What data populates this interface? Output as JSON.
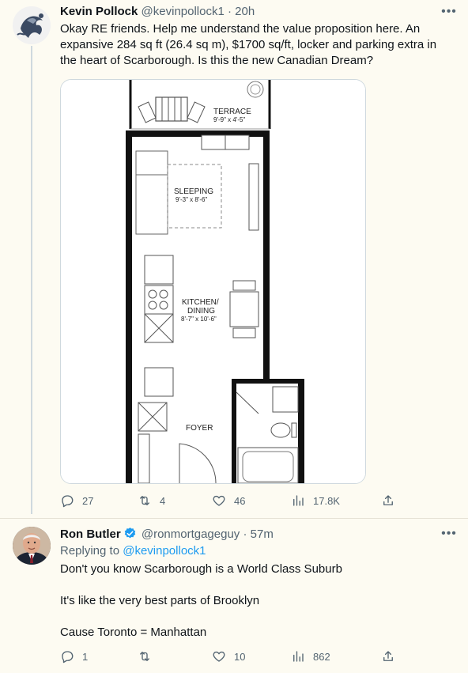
{
  "tweet1": {
    "author_name": "Kevin Pollock",
    "handle": "@kevinpollock1",
    "separator": "·",
    "time": "20h",
    "text_lines": [
      "Okay RE friends.  Help me understand the value proposition here.  An",
      "expansive 284 sq ft (26.4 sq m), $1700 sq/ft, locker and parking extra in",
      "the heart of Scarborough. Is this the new Canadian Dream?"
    ],
    "floorplan": {
      "terrace_label": "TERRACE",
      "terrace_dims": "9'-9\" x 4'-5\"",
      "sleeping_label": "SLEEPING",
      "sleeping_dims": "9'-3\" x 8'-6\"",
      "kitchen_label_1": "KITCHEN/",
      "kitchen_label_2": "DINING",
      "kitchen_dims": "8'-7\" x 10'-6\"",
      "foyer_label": "FOYER"
    },
    "stats": {
      "replies": "27",
      "retweets": "4",
      "likes": "46",
      "views": "17.8K"
    }
  },
  "tweet2": {
    "author_name": "Ron Butler",
    "handle": "@ronmortgageguy",
    "separator": "·",
    "time": "57m",
    "replying_prefix": "Replying to",
    "replying_handle": "@kevinpollock1",
    "paragraphs": [
      "Don't you know Scarborough is a World Class Suburb",
      "It's like the very best parts of Brooklyn",
      "Cause Toronto = Manhattan"
    ],
    "stats": {
      "replies": "1",
      "retweets": "",
      "likes": "10",
      "views": "862"
    }
  },
  "colors": {
    "background": "#fdfbf2",
    "text_primary": "#0f1419",
    "text_secondary": "#536471",
    "link": "#1d9bf0",
    "verified": "#1d9bf0",
    "line": "#cfd9de"
  },
  "icons": {
    "reply": "reply-icon",
    "retweet": "retweet-icon",
    "like": "heart-icon",
    "views": "views-icon",
    "share": "share-icon",
    "more": "more-icon",
    "verified": "verified-badge-icon"
  }
}
